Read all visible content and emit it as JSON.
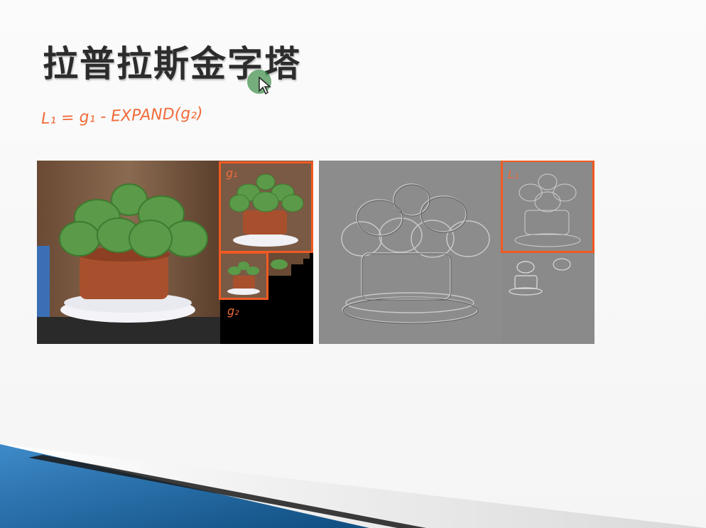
{
  "slide": {
    "title": "拉普拉斯金字塔",
    "formula": "L₁ = g₁ - EXPAND(g₂)",
    "labels": {
      "g1": "g₁",
      "g2": "g₂",
      "L1": "L₁"
    }
  },
  "colors": {
    "accent_orange": "#f15a22",
    "title_text": "#2c2c2c",
    "bottom_blue": "#1f6fa8",
    "cursor_green": "#3c8c46"
  },
  "icons": {
    "cursor": "mouse-pointer-icon"
  }
}
